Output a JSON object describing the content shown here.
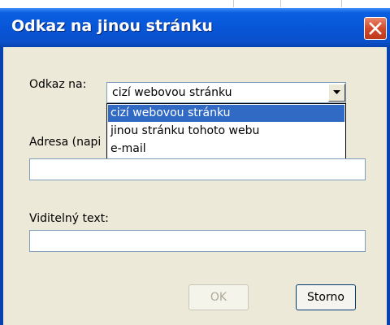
{
  "dialog": {
    "title": "Odkaz na jinou stránku"
  },
  "link_type": {
    "label": "Odkaz na:",
    "selected": "cizí webovou stránku",
    "options": [
      "cizí webovou stránku",
      "jinou stránku tohoto webu",
      "e-mail"
    ]
  },
  "address": {
    "label": "Adresa  (napi",
    "value": ""
  },
  "visible_text": {
    "label": "Viditelný text:",
    "value": ""
  },
  "buttons": {
    "ok_label": "OK",
    "cancel_label": "Storno"
  },
  "colors": {
    "title_bar": "#0856d8",
    "dialog_bg": "#ece9d8",
    "selection": "#316ac5",
    "close_button": "#d24a2a"
  },
  "icons": {
    "close": "close-icon",
    "dropdown": "chevron-down-icon"
  }
}
